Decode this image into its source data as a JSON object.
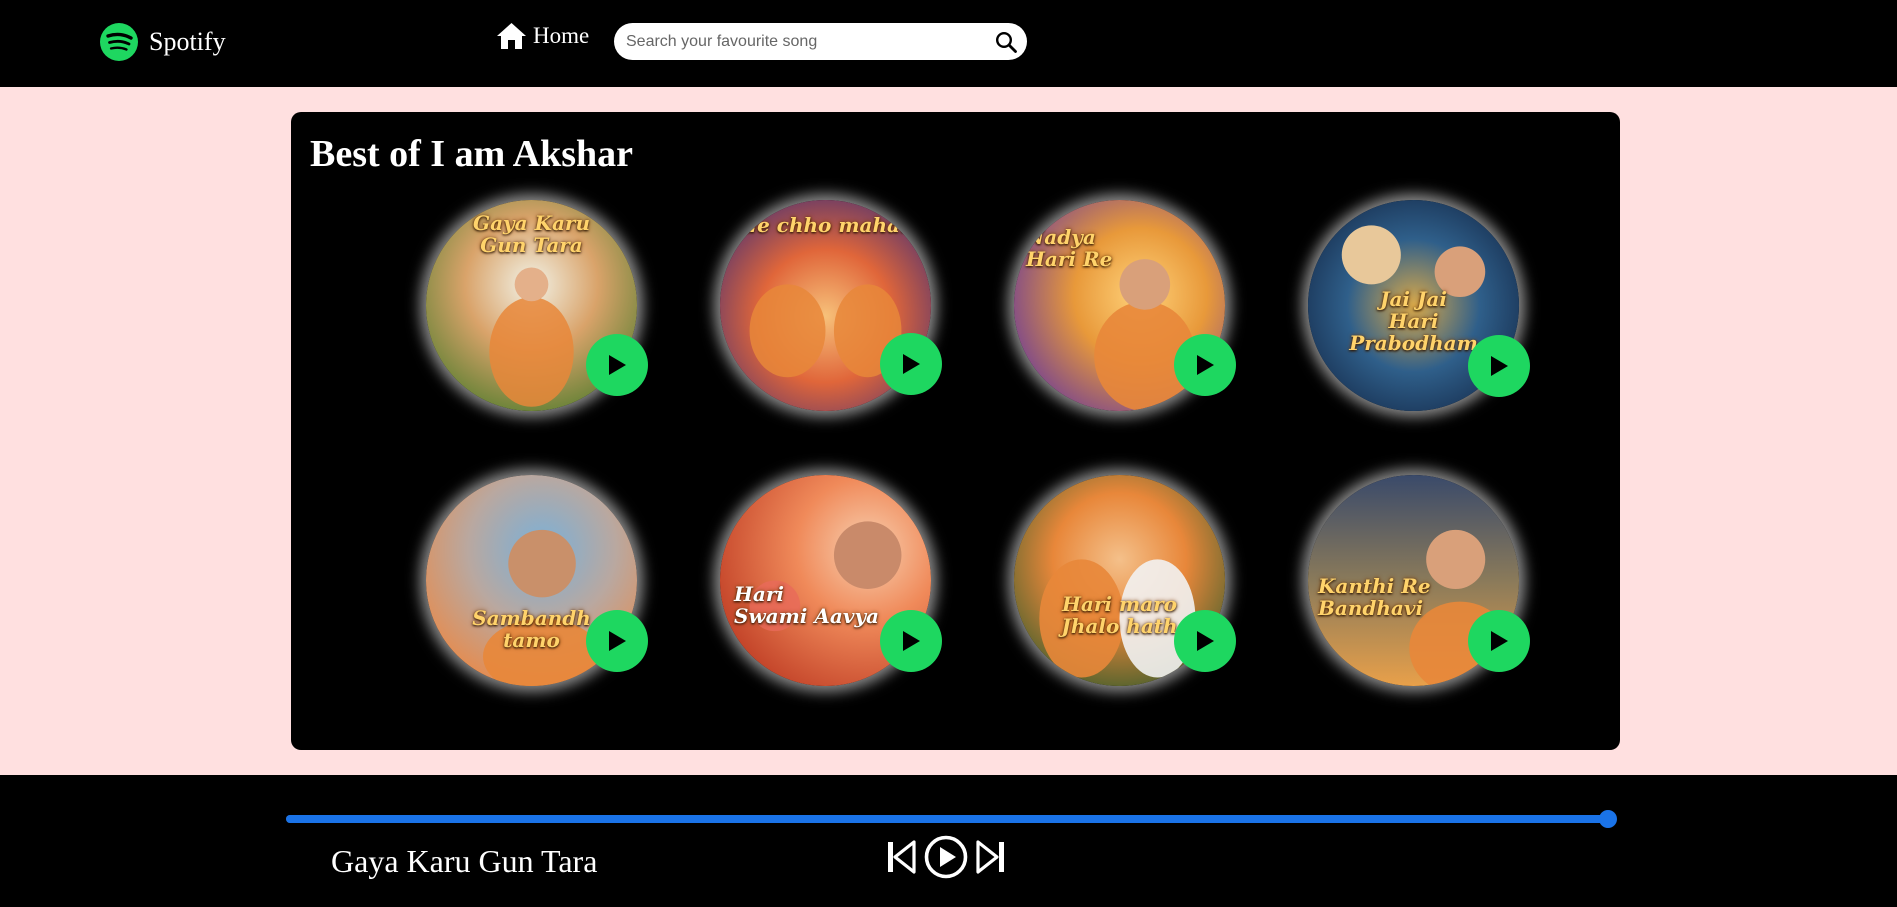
{
  "nav": {
    "brand": "Spotify",
    "home_label": "Home",
    "search_placeholder": "Search your favourite song",
    "icons": {
      "logo": "spotify-logo",
      "home": "home-icon",
      "search": "search-icon"
    }
  },
  "section": {
    "title": "Best of I am Akshar",
    "songs": [
      {
        "cover_text": "Gaya Karu\nGun Tara",
        "palette": [
          "#4a7a2a",
          "#d9a36a",
          "#f2f2e6"
        ]
      },
      {
        "cover_text": "Jode chho maharaj",
        "palette": [
          "#3b2a78",
          "#e0663a",
          "#f7c17a"
        ]
      },
      {
        "cover_text": "Nadya\nHari Re",
        "palette": [
          "#6a3a9a",
          "#e8993a",
          "#ffd27a"
        ]
      },
      {
        "cover_text": "Jai Jai\nHari\nPrabodham",
        "palette": [
          "#0e1d3a",
          "#2f5f8a",
          "#d9a94a"
        ]
      },
      {
        "cover_text": "Sambandh\ntamo",
        "palette": [
          "#b9a8a0",
          "#7ab0d8",
          "#e88a4a"
        ]
      },
      {
        "cover_text": "Hari\nSwami Aavya",
        "palette": [
          "#c4452a",
          "#f08a5a",
          "#f7d0b0"
        ]
      },
      {
        "cover_text": "Hari maro\nJhalo hath",
        "palette": [
          "#2f5a2a",
          "#e8873a",
          "#f4c08a"
        ]
      },
      {
        "cover_text": "Kanthi Re\nBandhavi",
        "palette": [
          "#3a4a6a",
          "#8a7a5a",
          "#e8a04a"
        ]
      }
    ]
  },
  "player": {
    "now_playing": "Gaya Karu Gun Tara",
    "progress": 1.0,
    "accent": "#1a73e8",
    "play_accent": "#1ed760",
    "icons": {
      "previous": "previous-icon",
      "play": "play-circle-icon",
      "next": "next-icon"
    }
  }
}
